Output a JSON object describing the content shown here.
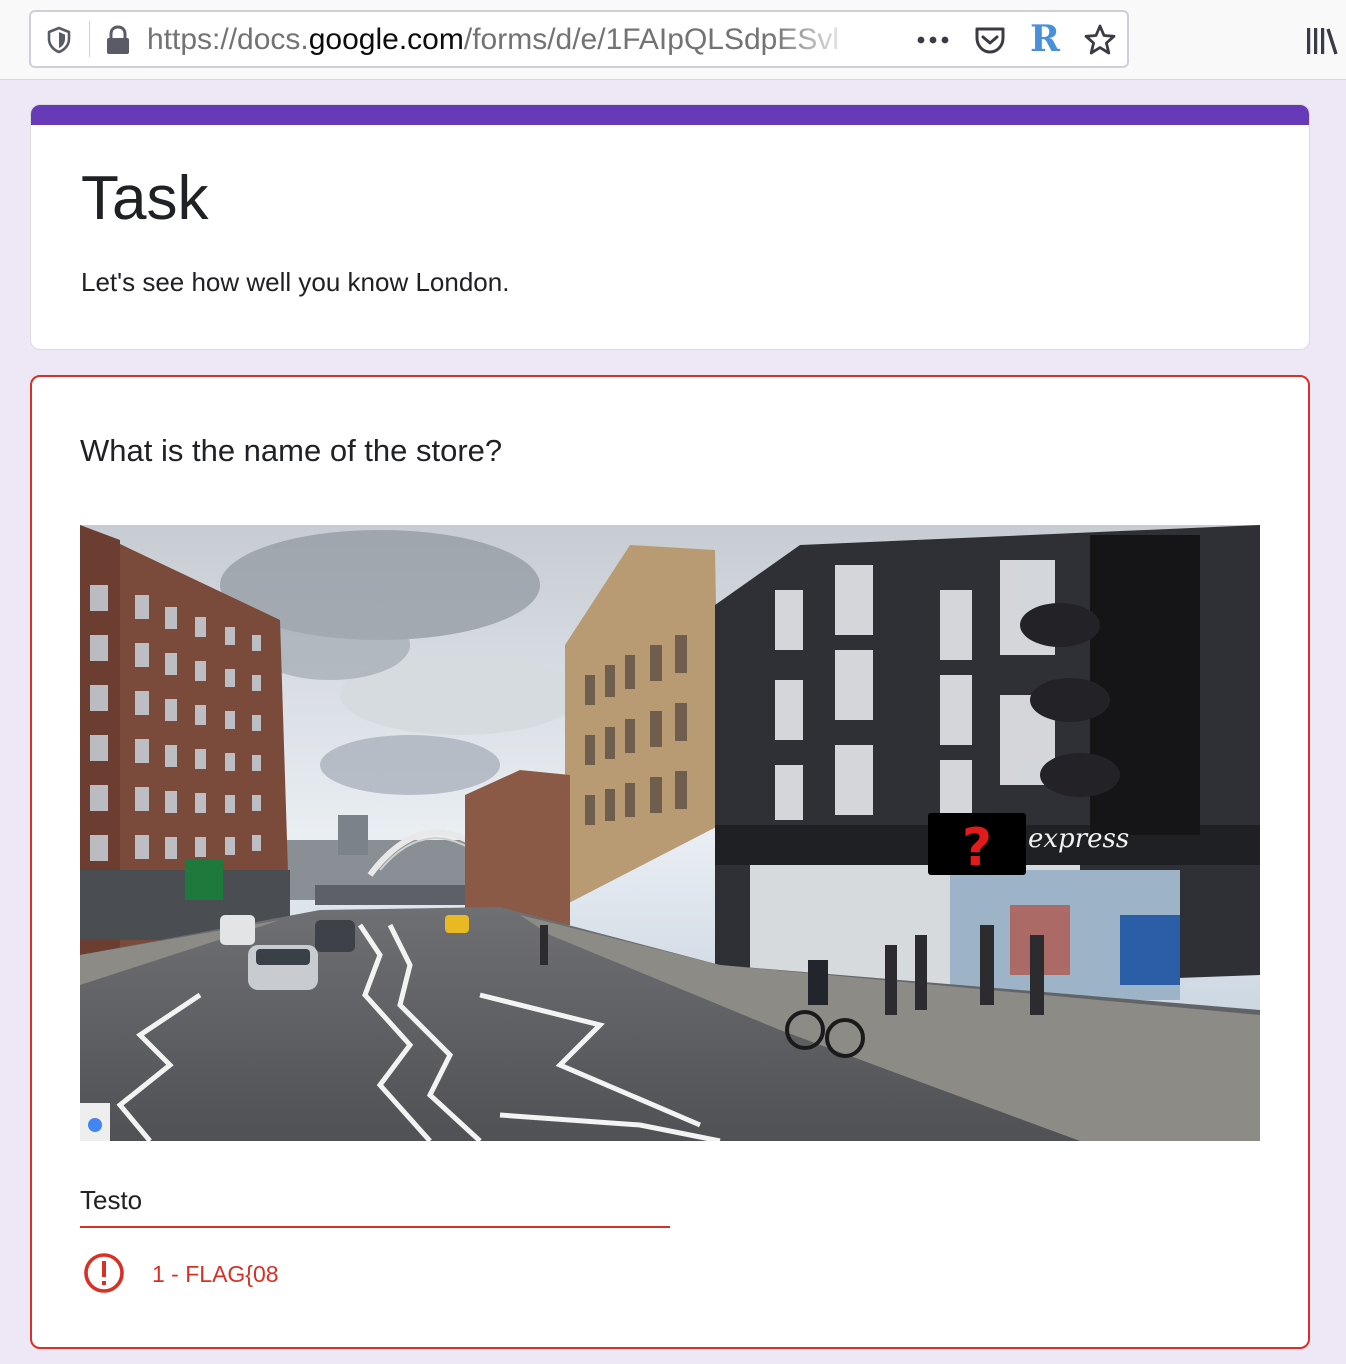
{
  "browser": {
    "url_prefix": "https://docs.",
    "url_domain": "google.com",
    "url_path": "/forms/d/e/1FAIpQLSdpESvl",
    "extension_letter": "R"
  },
  "form": {
    "title": "Task",
    "description": "Let's see how well you know London.",
    "accent_color": "#673ab7",
    "background_color": "#ede7f6"
  },
  "question": {
    "text": "What is the name of the store?",
    "image_store_sign": "express",
    "image_marker": "?",
    "answer_value": "Testo",
    "error_message": "1 - FLAG{08",
    "error_color": "#d93025"
  }
}
